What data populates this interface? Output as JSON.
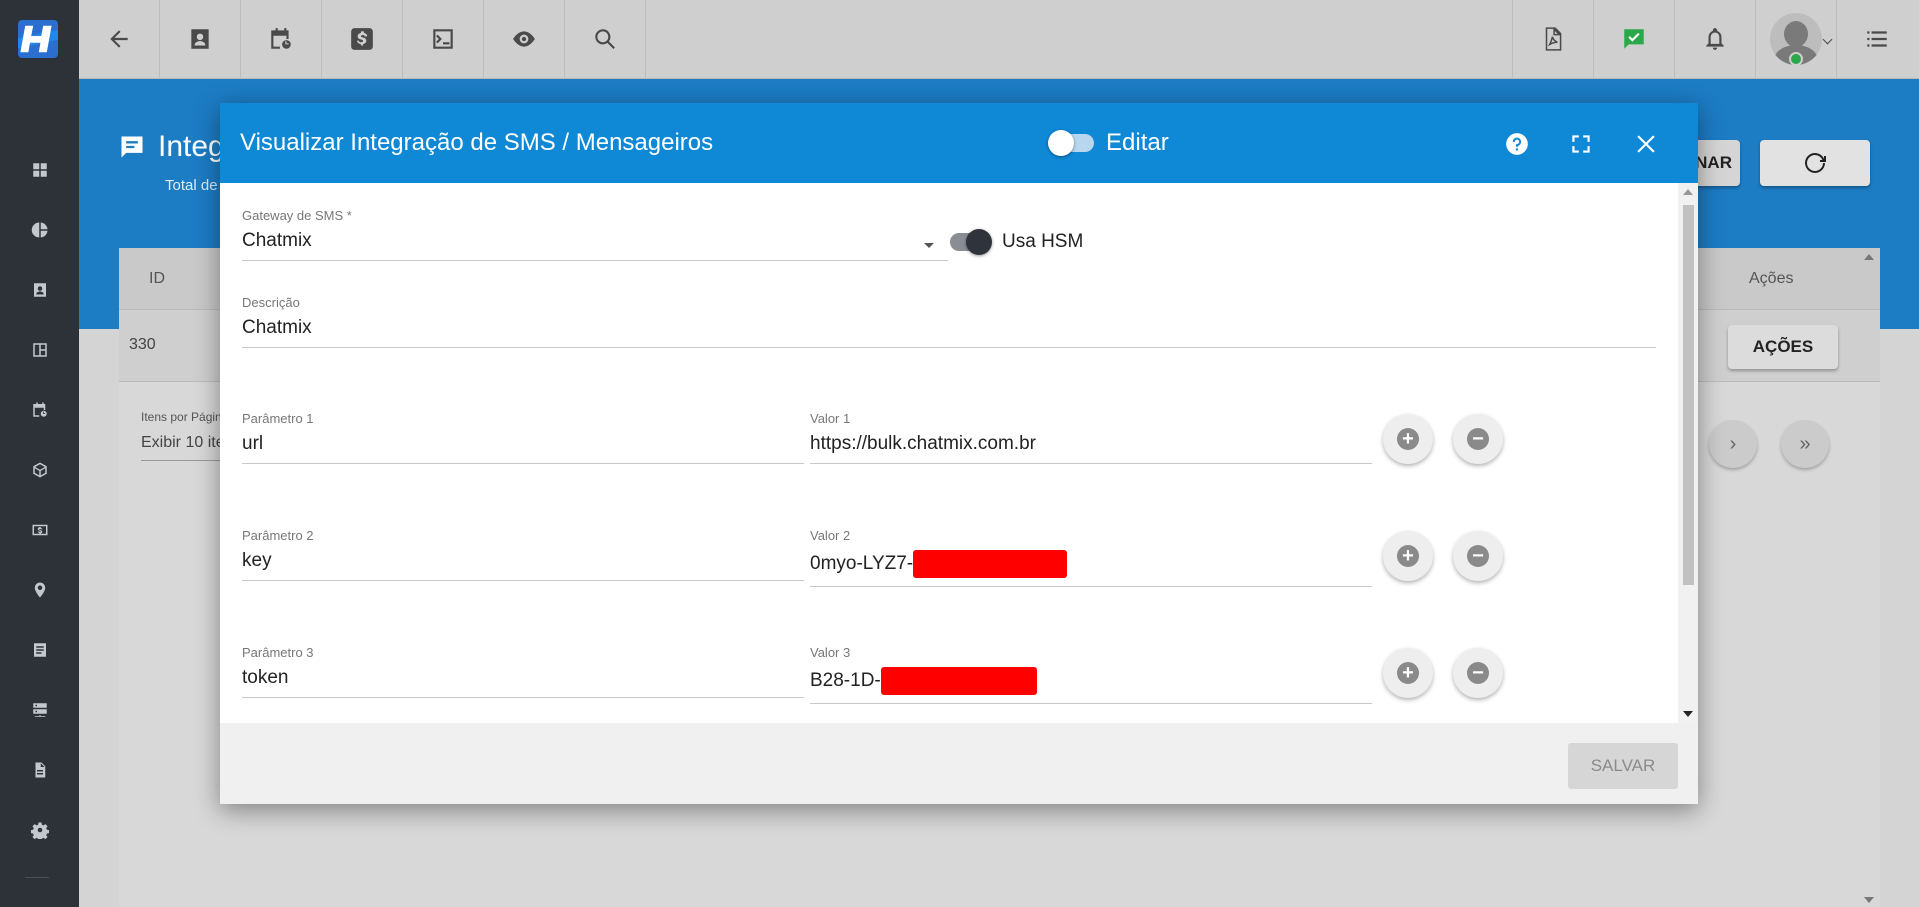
{
  "topbar": {
    "left_icons": [
      "back-arrow-icon",
      "contact-card-icon",
      "calendar-clock-icon",
      "dollar-icon",
      "terminal-icon",
      "eye-icon",
      "search-icon"
    ],
    "right_icons": [
      "pdf-icon",
      "chat-check-icon",
      "bell-icon",
      "user-avatar",
      "list-icon"
    ],
    "status_color": "#2aa84a"
  },
  "sidebar": {
    "icons": [
      "dashboard-icon",
      "pie-chart-icon",
      "contact-icon",
      "board-icon",
      "schedule-icon",
      "box-icon",
      "money-icon",
      "location-icon",
      "list-icon",
      "server-icon",
      "document-icon",
      "settings-icon"
    ]
  },
  "background_page": {
    "title": "Integ",
    "subtitle": "Total de",
    "header_button_partial": "NAR",
    "table": {
      "columns": [
        "ID",
        "Ações"
      ],
      "rows": [
        {
          "id": "330",
          "action_label": "AÇÕES"
        }
      ]
    },
    "pagination": {
      "label": "Itens por Págin",
      "select_value": "Exibir 10 ite"
    }
  },
  "modal": {
    "title": "Visualizar Integração de SMS / Mensageiros",
    "edit_label": "Editar",
    "edit_enabled": false,
    "header_color": "#0f88d6",
    "gateway": {
      "label": "Gateway de SMS *",
      "value": "Chatmix"
    },
    "hsm": {
      "label": "Usa HSM",
      "enabled": true
    },
    "descricao": {
      "label": "Descrição",
      "value": "Chatmix"
    },
    "params": [
      {
        "param_label": "Parâmetro 1",
        "param_value": "url",
        "valor_label": "Valor 1",
        "valor_value": "https://bulk.chatmix.com.br",
        "redacted": false
      },
      {
        "param_label": "Parâmetro 2",
        "param_value": "key",
        "valor_label": "Valor 2",
        "valor_value": "0myo-LYZ7-",
        "redacted": true
      },
      {
        "param_label": "Parâmetro 3",
        "param_value": "token",
        "valor_label": "Valor 3",
        "valor_value": "B28-1D-",
        "redacted": true
      }
    ],
    "save_label": "SALVAR",
    "redaction_color": "#ff0000"
  }
}
